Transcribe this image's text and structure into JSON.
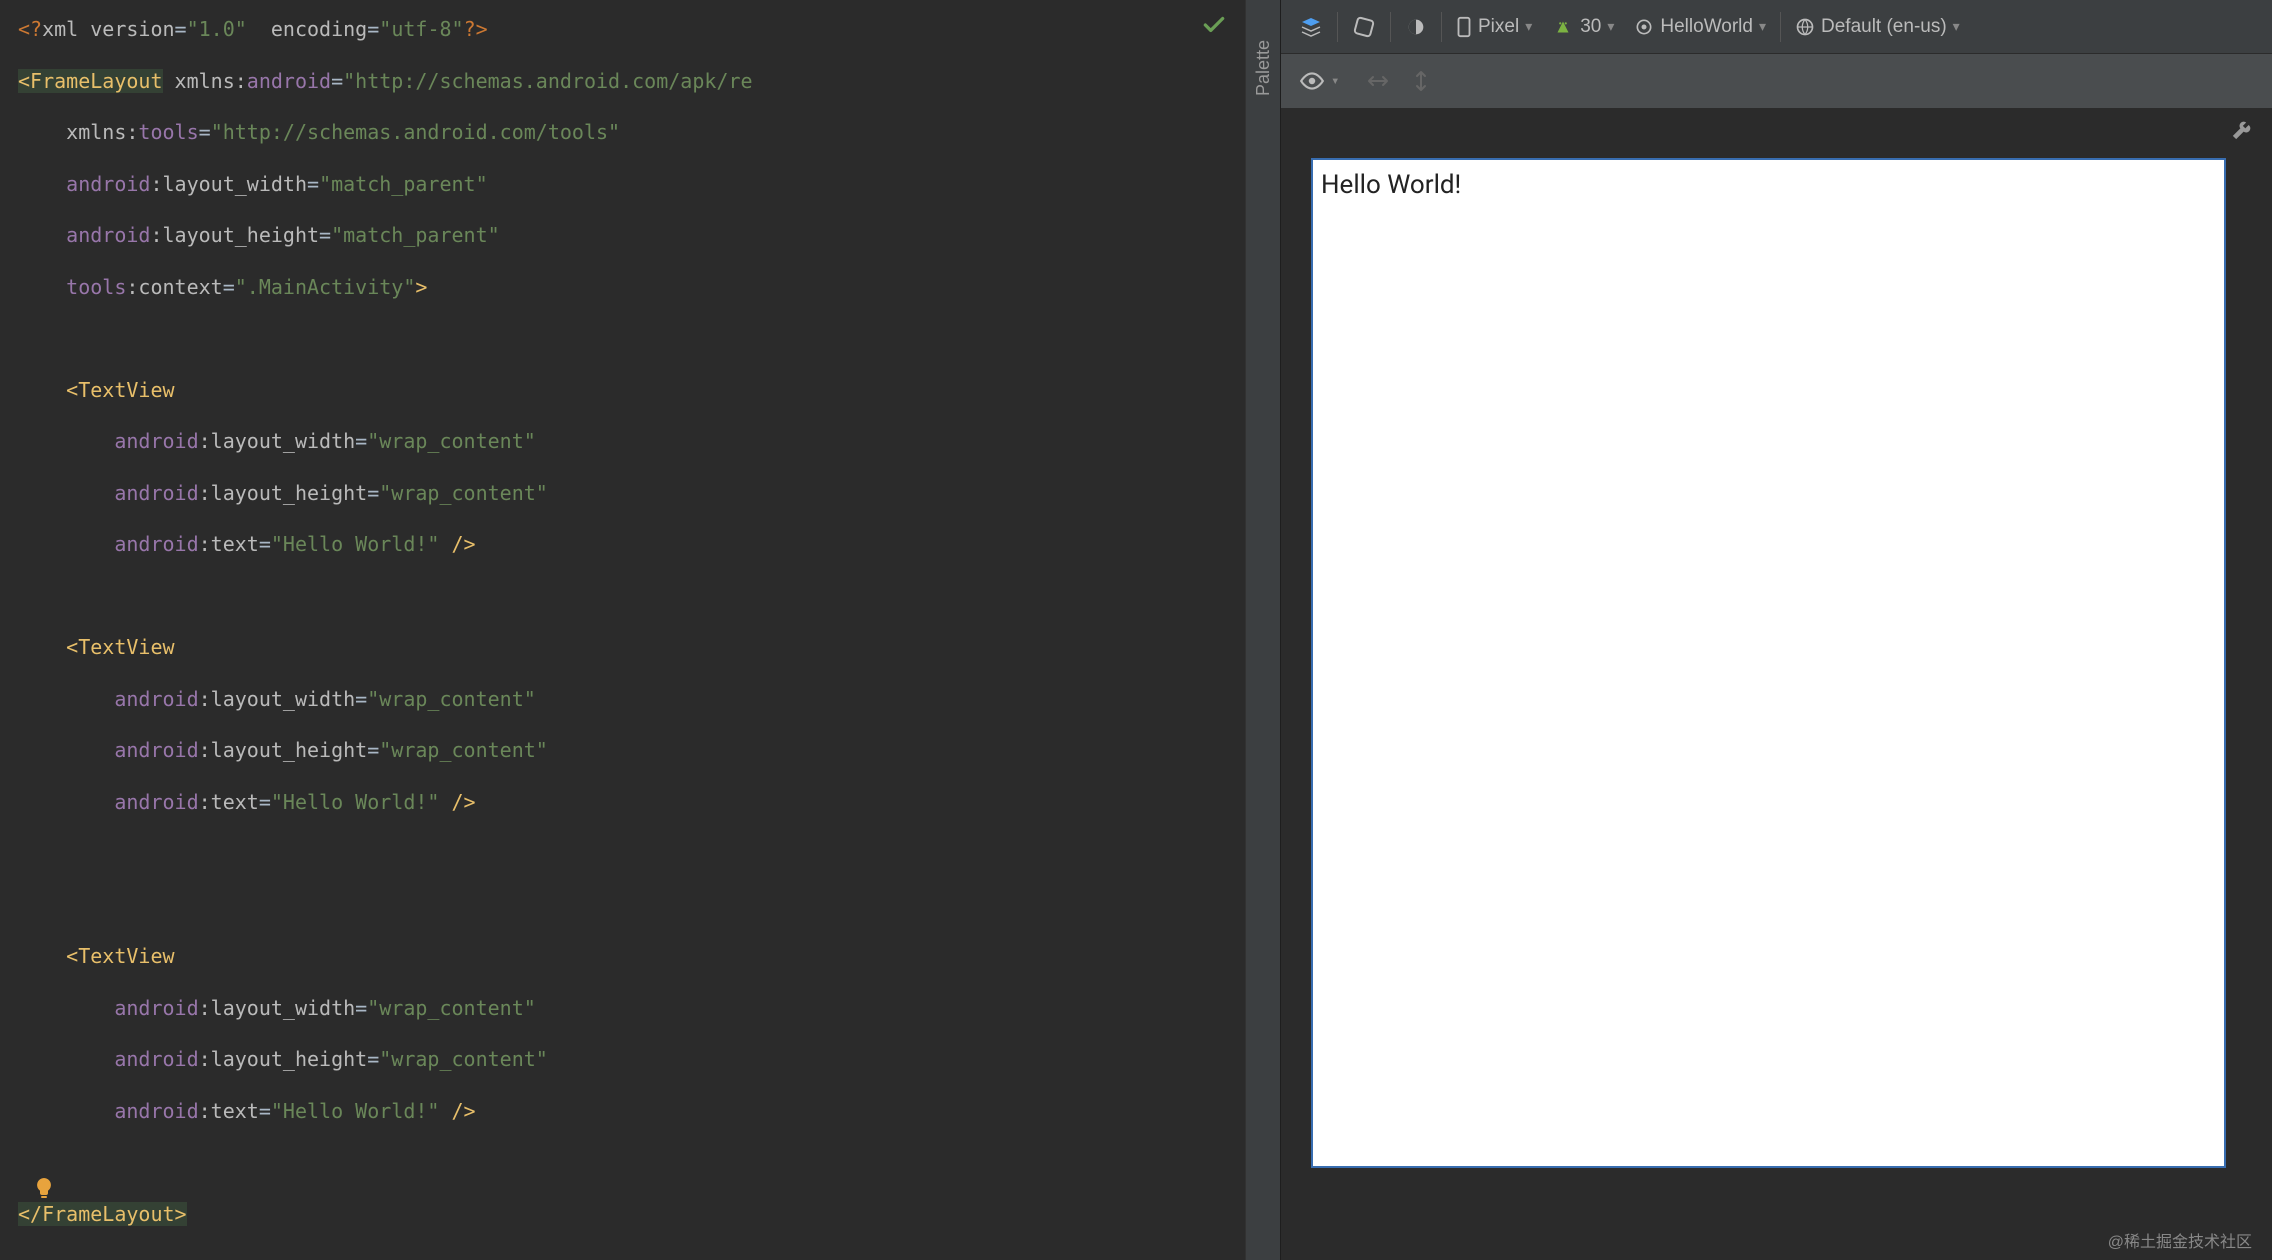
{
  "editor": {
    "check_title": "No problems",
    "lines": [
      [
        {
          "t": "<?",
          "c": "kw"
        },
        {
          "t": "xml version",
          "c": "attr-name"
        },
        {
          "t": "=",
          "c": "eq"
        },
        {
          "t": "\"1.0\"",
          "c": "str"
        },
        {
          "t": "  encoding",
          "c": "attr-name"
        },
        {
          "t": "=",
          "c": "eq"
        },
        {
          "t": "\"utf-8\"",
          "c": "str"
        },
        {
          "t": "?>",
          "c": "kw"
        }
      ],
      [
        {
          "t": "<FrameLayout",
          "c": "tag hl"
        },
        {
          "t": " ",
          "c": ""
        },
        {
          "t": "xmlns:",
          "c": "attr-name"
        },
        {
          "t": "android",
          "c": "attr-ns"
        },
        {
          "t": "=",
          "c": "eq"
        },
        {
          "t": "\"http://schemas.android.com/apk/re",
          "c": "str"
        }
      ],
      [
        {
          "t": "    ",
          "c": ""
        },
        {
          "t": "xmlns:",
          "c": "attr-name"
        },
        {
          "t": "tools",
          "c": "attr-ns"
        },
        {
          "t": "=",
          "c": "eq"
        },
        {
          "t": "\"http://schemas.android.com/tools\"",
          "c": "str"
        }
      ],
      [
        {
          "t": "    ",
          "c": ""
        },
        {
          "t": "android",
          "c": "attr-ns"
        },
        {
          "t": ":layout_width",
          "c": "attr-name"
        },
        {
          "t": "=",
          "c": "eq"
        },
        {
          "t": "\"match_parent\"",
          "c": "str"
        }
      ],
      [
        {
          "t": "    ",
          "c": ""
        },
        {
          "t": "android",
          "c": "attr-ns"
        },
        {
          "t": ":layout_height",
          "c": "attr-name"
        },
        {
          "t": "=",
          "c": "eq"
        },
        {
          "t": "\"match_parent\"",
          "c": "str"
        }
      ],
      [
        {
          "t": "    ",
          "c": ""
        },
        {
          "t": "tools",
          "c": "attr-ns"
        },
        {
          "t": ":context",
          "c": "attr-name"
        },
        {
          "t": "=",
          "c": "eq"
        },
        {
          "t": "\".MainActivity\"",
          "c": "str"
        },
        {
          "t": ">",
          "c": "tag"
        }
      ],
      [
        {
          "t": "",
          "c": ""
        }
      ],
      [
        {
          "t": "    ",
          "c": ""
        },
        {
          "t": "<TextView",
          "c": "tag"
        }
      ],
      [
        {
          "t": "        ",
          "c": ""
        },
        {
          "t": "android",
          "c": "attr-ns"
        },
        {
          "t": ":layout_width",
          "c": "attr-name"
        },
        {
          "t": "=",
          "c": "eq"
        },
        {
          "t": "\"wrap_content\"",
          "c": "str"
        }
      ],
      [
        {
          "t": "        ",
          "c": ""
        },
        {
          "t": "android",
          "c": "attr-ns"
        },
        {
          "t": ":layout_height",
          "c": "attr-name"
        },
        {
          "t": "=",
          "c": "eq"
        },
        {
          "t": "\"wrap_content\"",
          "c": "str"
        }
      ],
      [
        {
          "t": "        ",
          "c": ""
        },
        {
          "t": "android",
          "c": "attr-ns"
        },
        {
          "t": ":text",
          "c": "attr-name"
        },
        {
          "t": "=",
          "c": "eq"
        },
        {
          "t": "\"Hello World!\"",
          "c": "str"
        },
        {
          "t": " />",
          "c": "tag"
        }
      ],
      [
        {
          "t": "",
          "c": ""
        }
      ],
      [
        {
          "t": "    ",
          "c": ""
        },
        {
          "t": "<TextView",
          "c": "tag"
        }
      ],
      [
        {
          "t": "        ",
          "c": ""
        },
        {
          "t": "android",
          "c": "attr-ns"
        },
        {
          "t": ":layout_width",
          "c": "attr-name"
        },
        {
          "t": "=",
          "c": "eq"
        },
        {
          "t": "\"wrap_content\"",
          "c": "str"
        }
      ],
      [
        {
          "t": "        ",
          "c": ""
        },
        {
          "t": "android",
          "c": "attr-ns"
        },
        {
          "t": ":layout_height",
          "c": "attr-name"
        },
        {
          "t": "=",
          "c": "eq"
        },
        {
          "t": "\"wrap_content\"",
          "c": "str"
        }
      ],
      [
        {
          "t": "        ",
          "c": ""
        },
        {
          "t": "android",
          "c": "attr-ns"
        },
        {
          "t": ":text",
          "c": "attr-name"
        },
        {
          "t": "=",
          "c": "eq"
        },
        {
          "t": "\"Hello World!\"",
          "c": "str"
        },
        {
          "t": " />",
          "c": "tag"
        }
      ],
      [
        {
          "t": "",
          "c": ""
        }
      ],
      [
        {
          "t": "",
          "c": ""
        }
      ],
      [
        {
          "t": "    ",
          "c": ""
        },
        {
          "t": "<TextView",
          "c": "tag"
        }
      ],
      [
        {
          "t": "        ",
          "c": ""
        },
        {
          "t": "android",
          "c": "attr-ns"
        },
        {
          "t": ":layout_width",
          "c": "attr-name"
        },
        {
          "t": "=",
          "c": "eq"
        },
        {
          "t": "\"wrap_content\"",
          "c": "str"
        }
      ],
      [
        {
          "t": "        ",
          "c": ""
        },
        {
          "t": "android",
          "c": "attr-ns"
        },
        {
          "t": ":layout_height",
          "c": "attr-name"
        },
        {
          "t": "=",
          "c": "eq"
        },
        {
          "t": "\"wrap_content\"",
          "c": "str"
        }
      ],
      [
        {
          "t": "        ",
          "c": ""
        },
        {
          "t": "android",
          "c": "attr-ns"
        },
        {
          "t": ":text",
          "c": "attr-name"
        },
        {
          "t": "=",
          "c": "eq"
        },
        {
          "t": "\"Hello World!\"",
          "c": "str"
        },
        {
          "t": " />",
          "c": "tag"
        }
      ],
      [
        {
          "t": "",
          "c": ""
        }
      ],
      [
        {
          "t": "</FrameLayout>",
          "c": "tag hl"
        }
      ]
    ]
  },
  "palette": {
    "label": "Palette"
  },
  "toolbar": {
    "device": "Pixel",
    "api": "30",
    "theme": "HelloWorld",
    "locale": "Default (en-us)"
  },
  "preview": {
    "text": "Hello World!",
    "watermark": "@稀土掘金技术社区"
  }
}
